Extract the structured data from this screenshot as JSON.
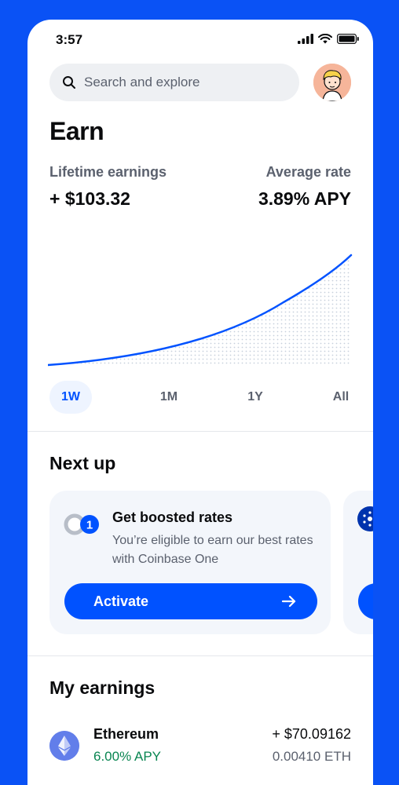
{
  "status_bar": {
    "time": "3:57"
  },
  "search": {
    "placeholder": "Search and explore"
  },
  "page": {
    "title": "Earn"
  },
  "stats": {
    "lifetime_label": "Lifetime earnings",
    "lifetime_value": "+ $103.32",
    "rate_label": "Average rate",
    "rate_value": "3.89% APY"
  },
  "ranges": [
    {
      "label": "1W",
      "active": true
    },
    {
      "label": "1M",
      "active": false
    },
    {
      "label": "1Y",
      "active": false
    },
    {
      "label": "All",
      "active": false
    }
  ],
  "next_up": {
    "title": "Next up",
    "card": {
      "title": "Get boosted rates",
      "description": "You’re eligible to earn our best rates with Coinbase One",
      "button": "Activate"
    }
  },
  "my_earnings": {
    "title": "My earnings",
    "items": [
      {
        "name": "Ethereum",
        "apy": "6.00% APY",
        "earned": "+ $70.09162",
        "amount": "0.00410 ETH"
      }
    ]
  },
  "colors": {
    "brand": "#0052ff",
    "background": "#0a52f5",
    "positive": "#098551"
  }
}
